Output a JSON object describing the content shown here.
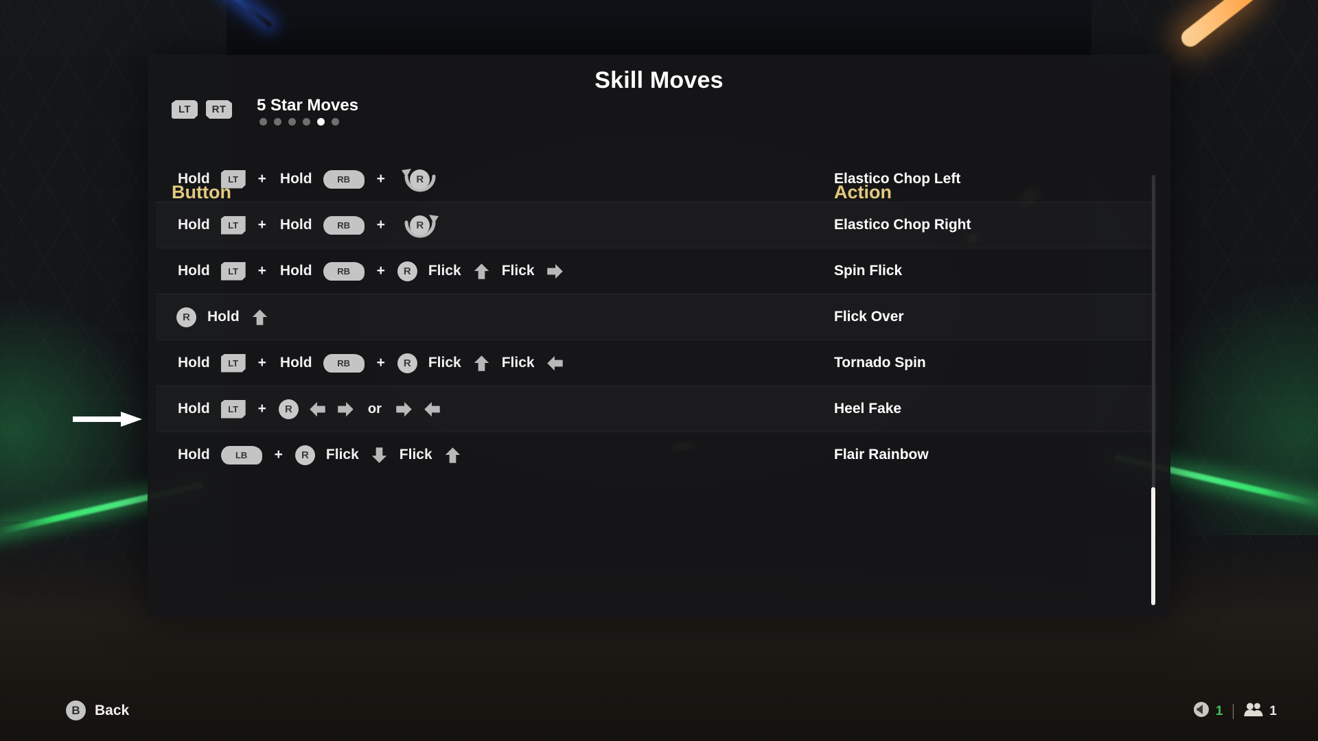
{
  "panel": {
    "title": "Skill Moves",
    "page_selector": {
      "left_trigger": "LT",
      "right_trigger": "RT",
      "label": "5 Star Moves",
      "total_pages": 6,
      "active_page_index": 4
    },
    "columns": {
      "button": "Button",
      "action": "Action"
    },
    "accent_color": "#e3c87e",
    "rows": [
      {
        "action": "Elastico Chop Left",
        "tokens": [
          {
            "type": "text",
            "value": "Hold"
          },
          {
            "type": "trigger",
            "value": "LT"
          },
          {
            "type": "plus",
            "value": "+"
          },
          {
            "type": "text",
            "value": "Hold"
          },
          {
            "type": "bumper",
            "value": "RB"
          },
          {
            "type": "plus",
            "value": "+"
          },
          {
            "type": "rotate",
            "value": "R",
            "direction": "counter-clockwise"
          }
        ]
      },
      {
        "action": "Elastico Chop Right",
        "tokens": [
          {
            "type": "text",
            "value": "Hold"
          },
          {
            "type": "trigger",
            "value": "LT"
          },
          {
            "type": "plus",
            "value": "+"
          },
          {
            "type": "text",
            "value": "Hold"
          },
          {
            "type": "bumper",
            "value": "RB"
          },
          {
            "type": "plus",
            "value": "+"
          },
          {
            "type": "rotate",
            "value": "R",
            "direction": "clockwise"
          }
        ]
      },
      {
        "action": "Spin Flick",
        "tokens": [
          {
            "type": "text",
            "value": "Hold"
          },
          {
            "type": "trigger",
            "value": "LT"
          },
          {
            "type": "plus",
            "value": "+"
          },
          {
            "type": "text",
            "value": "Hold"
          },
          {
            "type": "bumper",
            "value": "RB"
          },
          {
            "type": "plus",
            "value": "+"
          },
          {
            "type": "stick",
            "value": "R"
          },
          {
            "type": "text",
            "value": "Flick"
          },
          {
            "type": "arrow",
            "value": "up"
          },
          {
            "type": "text",
            "value": "Flick"
          },
          {
            "type": "arrow",
            "value": "right"
          }
        ]
      },
      {
        "action": "Flick Over",
        "tokens": [
          {
            "type": "stick",
            "value": "R"
          },
          {
            "type": "text",
            "value": "Hold"
          },
          {
            "type": "arrow",
            "value": "up"
          }
        ]
      },
      {
        "action": "Tornado Spin",
        "tokens": [
          {
            "type": "text",
            "value": "Hold"
          },
          {
            "type": "trigger",
            "value": "LT"
          },
          {
            "type": "plus",
            "value": "+"
          },
          {
            "type": "text",
            "value": "Hold"
          },
          {
            "type": "bumper",
            "value": "RB"
          },
          {
            "type": "plus",
            "value": "+"
          },
          {
            "type": "stick",
            "value": "R"
          },
          {
            "type": "text",
            "value": "Flick"
          },
          {
            "type": "arrow",
            "value": "up"
          },
          {
            "type": "text",
            "value": "Flick"
          },
          {
            "type": "arrow",
            "value": "left"
          }
        ]
      },
      {
        "action": "Heel Fake",
        "tokens": [
          {
            "type": "text",
            "value": "Hold"
          },
          {
            "type": "trigger",
            "value": "LT"
          },
          {
            "type": "plus",
            "value": "+"
          },
          {
            "type": "stick",
            "value": "R"
          },
          {
            "type": "arrow",
            "value": "left"
          },
          {
            "type": "arrow",
            "value": "right"
          },
          {
            "type": "or",
            "value": "or"
          },
          {
            "type": "arrow",
            "value": "right"
          },
          {
            "type": "arrow",
            "value": "left"
          }
        ]
      },
      {
        "action": "Flair Rainbow",
        "tokens": [
          {
            "type": "text",
            "value": "Hold"
          },
          {
            "type": "bumper",
            "value": "LB"
          },
          {
            "type": "plus",
            "value": "+"
          },
          {
            "type": "stick",
            "value": "R"
          },
          {
            "type": "text",
            "value": "Flick"
          },
          {
            "type": "arrow",
            "value": "down"
          },
          {
            "type": "text",
            "value": "Flick"
          },
          {
            "type": "arrow",
            "value": "up"
          }
        ]
      }
    ]
  },
  "bottom_bar": {
    "back_button_glyph": "B",
    "back_label": "Back",
    "audio_count": "1",
    "audio_count_color": "#3ec45c",
    "players_count": "1"
  },
  "annotation": {
    "pointer": "right-arrow",
    "points_at_row_index": 4
  }
}
